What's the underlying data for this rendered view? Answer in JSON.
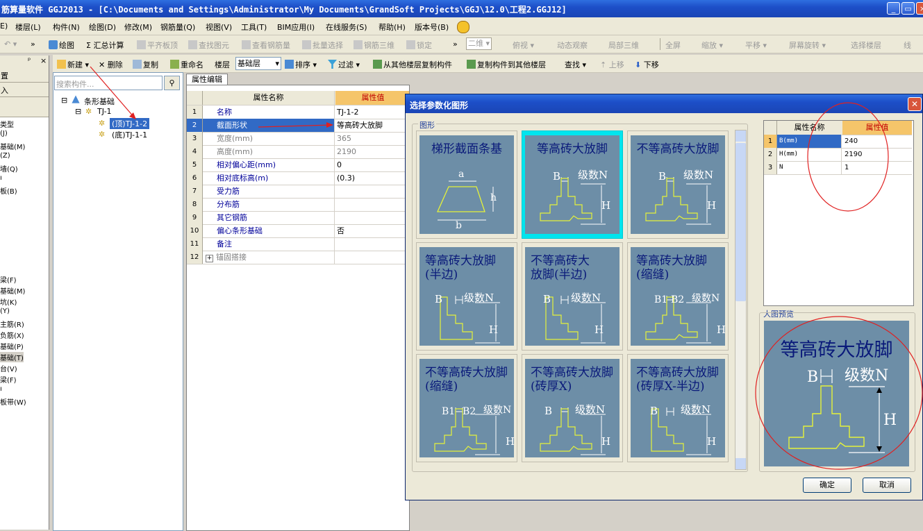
{
  "window": {
    "title": "筋算量软件 GGJ2013 - [C:\\Documents and Settings\\Administrator\\My Documents\\GrandSoft Projects\\GGJ\\12.0\\工程2.GGJ12]",
    "controls": [
      "_",
      "▭",
      "×"
    ]
  },
  "menu": [
    "E)",
    "楼层(L)",
    "构件(N)",
    "绘图(D)",
    "修改(M)",
    "钢筋量(Q)",
    "视图(V)",
    "工具(T)",
    "BIM应用(I)",
    "在线服务(S)",
    "帮助(H)",
    "版本号(B)"
  ],
  "toolbar1": {
    "items": [
      "绘图",
      "Σ 汇总计算",
      "平齐板顶",
      "查找图元",
      "查看钢筋量",
      "批量选择",
      "钢筋三维",
      "锁定",
      "二维",
      "俯视",
      "动态观察",
      "局部三维",
      "全屏",
      "缩放",
      "平移",
      "屏幕旋转",
      "选择楼层",
      "线"
    ]
  },
  "toolbar2": {
    "new": "新建",
    "delete": "删除",
    "copy": "复制",
    "rename": "重命名",
    "floor_label": "楼层",
    "floor_value": "基础层",
    "sort": "排序",
    "filter": "过滤",
    "copy_from": "从其他楼层复制构件",
    "copy_to": "复制构件到其他楼层",
    "find": "查找",
    "move_up": "上移",
    "move_down": "下移"
  },
  "left_panel": {
    "header_labels": [
      "置",
      "入"
    ],
    "items_top": [
      "类型",
      "(J)",
      "基础(M)",
      "(Z)",
      "墙(Q)",
      "ı",
      "板(B)"
    ],
    "items_bottom": [
      "梁(F)",
      "基础(M)",
      "坑(K)",
      "(Y)",
      "主筋(R)",
      "负筋(X)",
      "基础(P)",
      "基础(T)",
      "台(V)",
      "梁(F)",
      "ı",
      "板带(W)"
    ]
  },
  "tree": {
    "search_placeholder": "搜索构件...",
    "root": "条形基础",
    "child": "TJ-1",
    "leaf1": "(顶)TJ-1-2",
    "leaf2": "(底)TJ-1-1"
  },
  "property_grid": {
    "tab": "属性编辑",
    "col_name": "属性名称",
    "col_value": "属性值",
    "rows": [
      {
        "num": "1",
        "name": "名称",
        "value": "TJ-1-2"
      },
      {
        "num": "2",
        "name": "截面形状",
        "value": "等高砖大放脚"
      },
      {
        "num": "3",
        "name": "宽度(mm)",
        "value": "365"
      },
      {
        "num": "4",
        "name": "高度(mm)",
        "value": "2190"
      },
      {
        "num": "5",
        "name": "相对偏心距(mm)",
        "value": "0"
      },
      {
        "num": "6",
        "name": "相对底标高(m)",
        "value": "(0.3)"
      },
      {
        "num": "7",
        "name": "受力筋",
        "value": ""
      },
      {
        "num": "8",
        "name": "分布筋",
        "value": ""
      },
      {
        "num": "9",
        "name": "其它钢筋",
        "value": ""
      },
      {
        "num": "10",
        "name": "偏心条形基础",
        "value": "否"
      },
      {
        "num": "11",
        "name": "备注",
        "value": ""
      },
      {
        "num": "12",
        "name": "锚固搭接",
        "value": ""
      }
    ]
  },
  "dialog": {
    "title": "选择参数化图形",
    "group_label": "图形",
    "preview_label": "大图预览",
    "ok": "确定",
    "cancel": "取消",
    "shapes": [
      {
        "caption": [
          "梯形截面条基"
        ],
        "labels": [
          "a",
          "h",
          "b"
        ]
      },
      {
        "caption": [
          "等高砖大放脚"
        ],
        "labels": [
          "B",
          "级数N",
          "H"
        ]
      },
      {
        "caption": [
          "不等高砖大放脚"
        ],
        "labels": [
          "B",
          "级数N",
          "H"
        ]
      },
      {
        "caption": [
          "等高砖大放脚",
          "(半边)"
        ],
        "labels": [
          "B",
          "级数N",
          "H"
        ]
      },
      {
        "caption": [
          "不等高砖大",
          "放脚(半边)"
        ],
        "labels": [
          "B",
          "级数N",
          "H"
        ]
      },
      {
        "caption": [
          "等高砖大放脚",
          "(缩缝)"
        ],
        "labels": [
          "B1",
          "B2",
          "级数N",
          "H"
        ]
      },
      {
        "caption": [
          "不等高砖大放脚",
          "(缩缝)"
        ],
        "labels": [
          "B1",
          "B2",
          "级数N",
          "H"
        ]
      },
      {
        "caption": [
          "不等高砖大放脚",
          "(砖厚X)"
        ],
        "labels": [
          "B",
          "级数N",
          "H"
        ]
      },
      {
        "caption": [
          "不等高砖大放脚",
          "(砖厚X-半边)"
        ],
        "labels": [
          "B",
          "级数N",
          "H"
        ]
      }
    ],
    "param_grid": {
      "col_name": "属性名称",
      "col_value": "属性值",
      "rows": [
        {
          "num": "1",
          "name": "B(mm)",
          "value": "240"
        },
        {
          "num": "2",
          "name": "H(mm)",
          "value": "2190"
        },
        {
          "num": "3",
          "name": "N",
          "value": "1"
        }
      ]
    },
    "preview": {
      "caption": "等高砖大放脚",
      "labels": [
        "B",
        "级数N",
        "H"
      ]
    }
  },
  "colors": {
    "accent_selected": "#316ac5",
    "thumb_bg": "#6d8ea7",
    "thumb_selected": "#00e5ee",
    "header_orange": "#f5c56a",
    "annotation_red": "#e02020"
  }
}
